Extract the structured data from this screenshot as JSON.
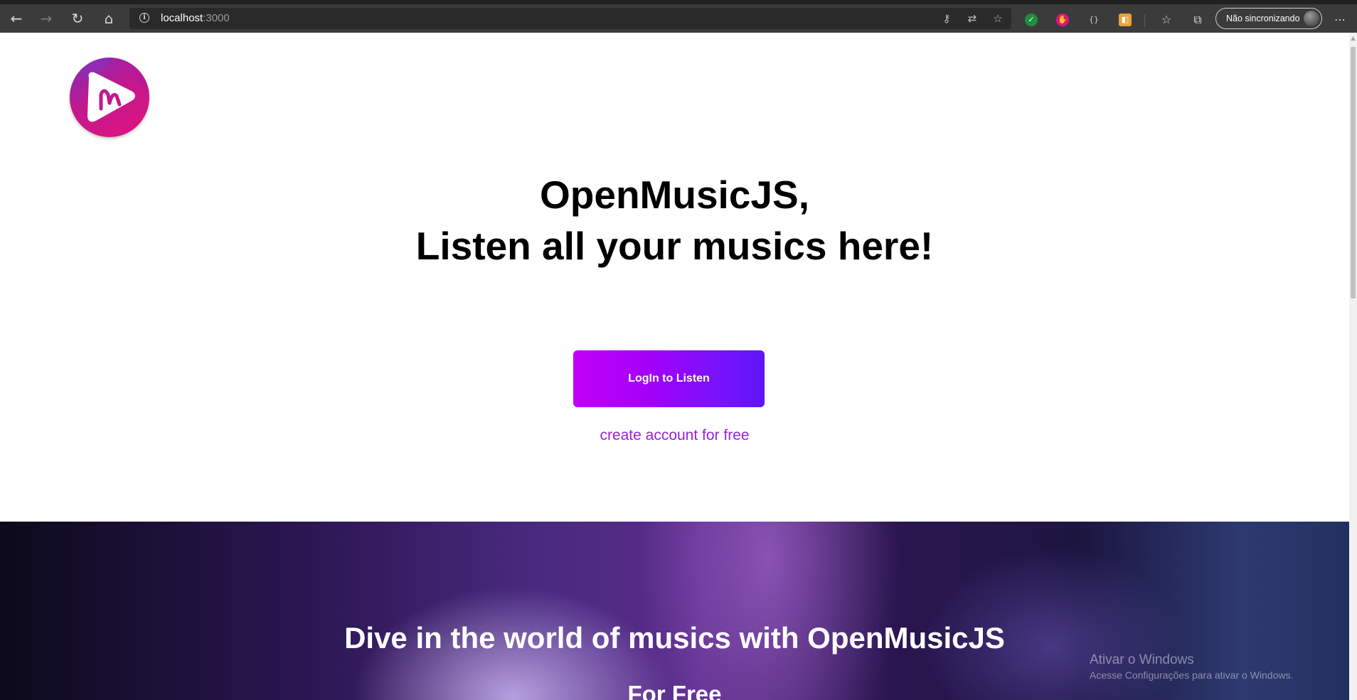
{
  "browser": {
    "url_host": "localhost",
    "url_port": ":3000",
    "sync_label": "Não sincronizando",
    "icons": {
      "back": "back-arrow-icon",
      "forward": "forward-arrow-icon",
      "refresh": "refresh-icon",
      "home": "home-icon",
      "info": "info-icon"
    }
  },
  "page": {
    "logo_alt": "OpenMusicJS logo",
    "headline_line1": "OpenMusicJS,",
    "headline_line2": "Listen all your musics here!",
    "login_button": "LogIn to Listen",
    "create_account_link": "create account for free",
    "hero_title": "Dive in the world of musics with OpenMusicJS",
    "hero_subtitle": "For Free"
  },
  "watermark": {
    "title": "Ativar o Windows",
    "subtitle": "Acesse Configurações para ativar o Windows."
  },
  "colors": {
    "brand_purple": "#9c21d6",
    "button_start": "#c100f7",
    "button_end": "#5e14fa",
    "logo_pink": "#e0147c"
  }
}
